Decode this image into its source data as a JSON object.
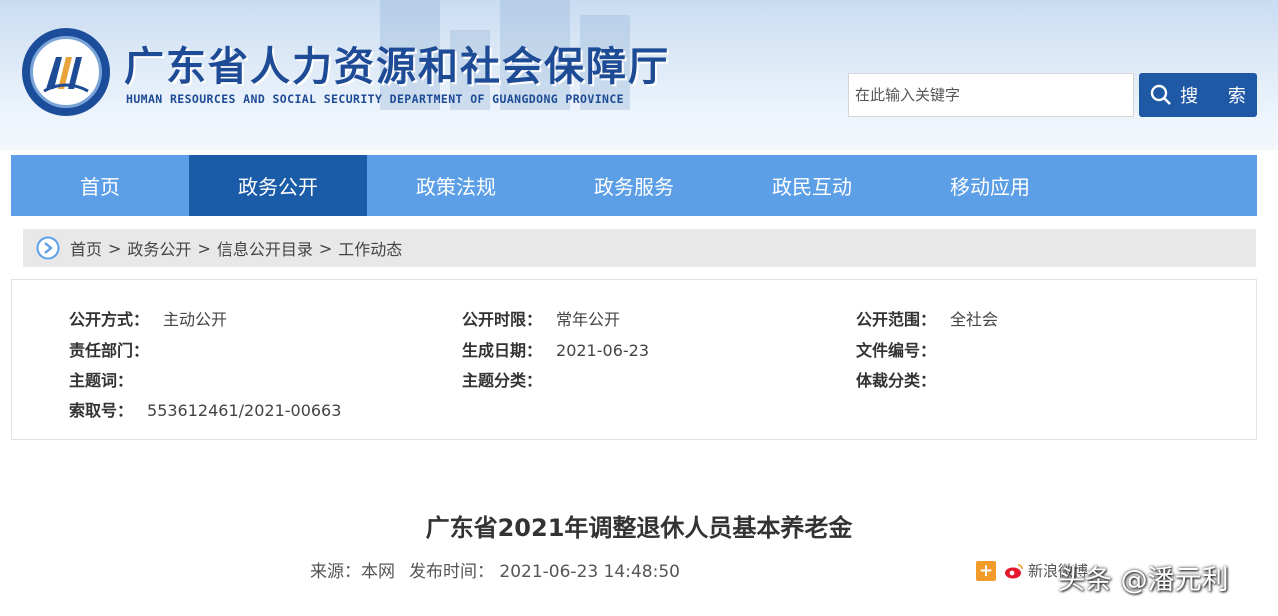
{
  "header": {
    "title": "广东省人力资源和社会保障厅",
    "subtitle": "HUMAN RESOURCES AND SOCIAL SECURITY DEPARTMENT OF GUANGDONG PROVINCE",
    "search_placeholder": "在此输入关键字",
    "search_button": "搜 索"
  },
  "nav": {
    "items": [
      "首页",
      "政务公开",
      "政策法规",
      "政务服务",
      "政民互动",
      "移动应用"
    ],
    "active_index": 1
  },
  "breadcrumb": {
    "items": [
      "首页",
      "政务公开",
      "信息公开目录",
      "工作动态"
    ],
    "separator": ">"
  },
  "info": {
    "public_method_label": "公开方式：",
    "public_method_value": "主动公开",
    "public_period_label": "公开时限：",
    "public_period_value": "常年公开",
    "public_scope_label": "公开范围：",
    "public_scope_value": "全社会",
    "department_label": "责任部门：",
    "created_date_label": "生成日期：",
    "created_date_value": "2021-06-23",
    "doc_number_label": "文件编号：",
    "subject_words_label": "主题词：",
    "subject_category_label": "主题分类：",
    "genre_label": "体裁分类：",
    "index_number_label": "索取号：",
    "index_number_value": "553612461/2021-00663"
  },
  "article": {
    "title": "广东省2021年调整退休人员基本养老金",
    "source": "来源：本网",
    "publish_time": "发布时间： 2021-06-23 14:48:50"
  },
  "share": {
    "plus": "+",
    "weibo_label": "新浪微博"
  },
  "watermark": "头条 @潘元利",
  "colors": {
    "brand_blue": "#1e4b95",
    "nav_blue": "#5c9fe7",
    "nav_active": "#1a5ca8",
    "search_button": "#1f58a5",
    "breadcrumb_bg": "#e8e8e8"
  }
}
